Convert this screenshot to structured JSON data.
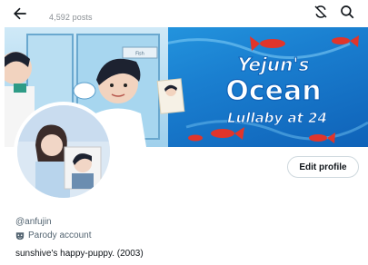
{
  "header": {
    "posts_count": "4,592 posts"
  },
  "banner": {
    "title_line1": "Yejun's",
    "title_line2": "Ocean",
    "title_line3": "Lullaby at 24",
    "sign_text": "Fish"
  },
  "profile": {
    "edit_label": "Edit profile",
    "handle": "@anfujin",
    "parody_label": "Parody account",
    "bio": "sunshive's happy-puppy. (2003)"
  },
  "colors": {
    "banner_blue": "#1f8fd6",
    "text_secondary": "#536471",
    "border": "#cfd9de"
  }
}
